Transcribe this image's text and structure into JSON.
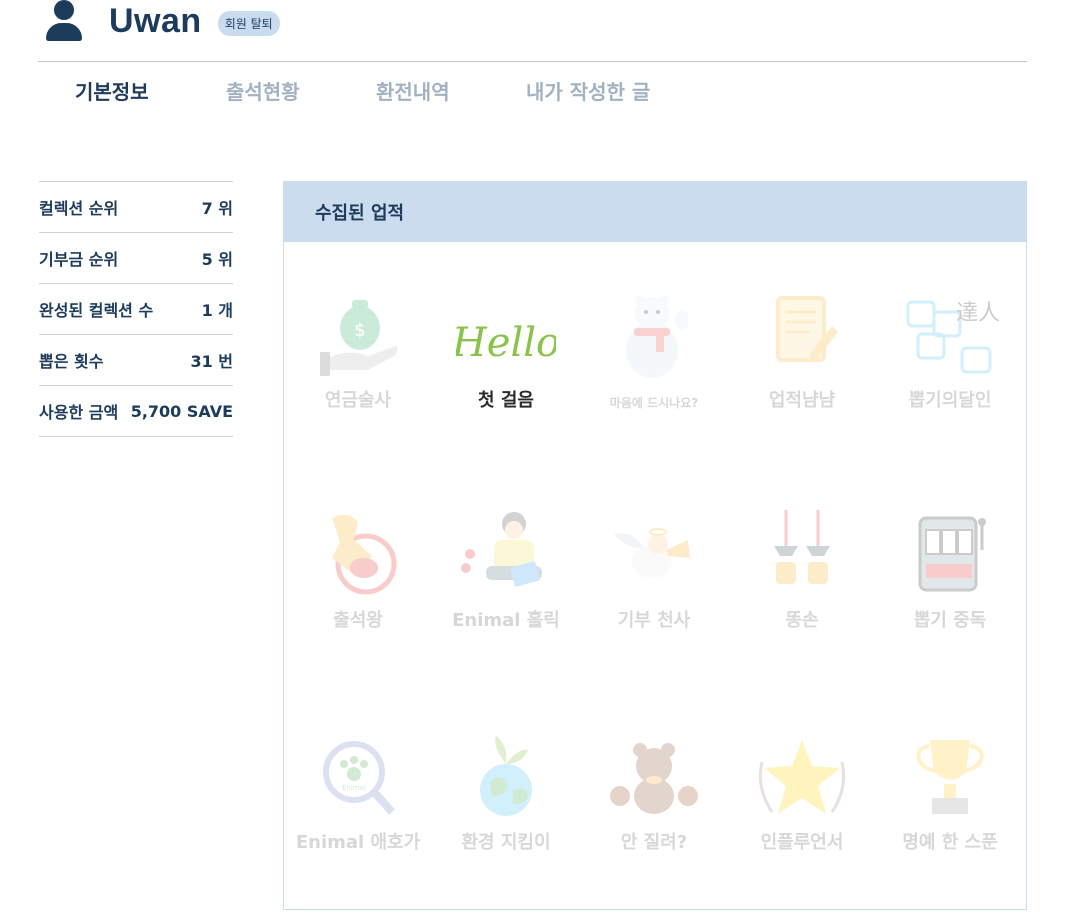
{
  "profile": {
    "username": "Uwan",
    "withdraw_label": "회원 탈퇴"
  },
  "tabs": [
    {
      "label": "기본정보",
      "active": true
    },
    {
      "label": "출석현황",
      "active": false
    },
    {
      "label": "환전내역",
      "active": false
    },
    {
      "label": "내가 작성한 글",
      "active": false
    }
  ],
  "stats": [
    {
      "label": "컬렉션 순위",
      "value": "7 위"
    },
    {
      "label": "기부금 순위",
      "value": "5 위"
    },
    {
      "label": "완성된 컬렉션 수",
      "value": "1 개"
    },
    {
      "label": "뽑은 횟수",
      "value": "31 번"
    },
    {
      "label": "사용한 금액",
      "value": "5,700 SAVE"
    }
  ],
  "achievements": {
    "title": "수집된 업적",
    "items": [
      {
        "label": "연금술사",
        "icon": "money-bag-hand-icon",
        "earned": false
      },
      {
        "label": "첫 걸음",
        "icon": "hello-script-icon",
        "art_text": "Hello",
        "earned": true
      },
      {
        "label": "마음에 드시나요?",
        "icon": "polar-bear-icon",
        "earned": false
      },
      {
        "label": "업적냠냠",
        "icon": "notepad-pencil-icon",
        "earned": false
      },
      {
        "label": "뽑기의달인",
        "icon": "puzzle-master-icon",
        "art_text": "達人",
        "earned": false
      },
      {
        "label": "출석왕",
        "icon": "stamp-icon",
        "earned": false
      },
      {
        "label": "Enimal 홀릭",
        "icon": "tablet-boy-icon",
        "earned": false
      },
      {
        "label": "기부 천사",
        "icon": "angel-trumpet-icon",
        "earned": false
      },
      {
        "label": "똥손",
        "icon": "claw-machine-icon",
        "earned": false
      },
      {
        "label": "뽑기 중독",
        "icon": "slot-machine-icon",
        "earned": false
      },
      {
        "label": "Enimal 애호가",
        "icon": "paw-magnifier-icon",
        "art_text": "Enimal",
        "earned": false
      },
      {
        "label": "환경 지킴이",
        "icon": "earth-sprout-icon",
        "earned": false
      },
      {
        "label": "안 질려?",
        "icon": "teddy-bears-icon",
        "earned": false
      },
      {
        "label": "인플루언서",
        "icon": "star-laurel-icon",
        "earned": false
      },
      {
        "label": "명예 한 스푼",
        "icon": "trophy-icon",
        "earned": false
      }
    ]
  },
  "colors": {
    "navy": "#1d3b5b",
    "tab_inactive": "#a3b2c2",
    "panel_header": "#cadcee",
    "badge": "#c9dcef"
  }
}
